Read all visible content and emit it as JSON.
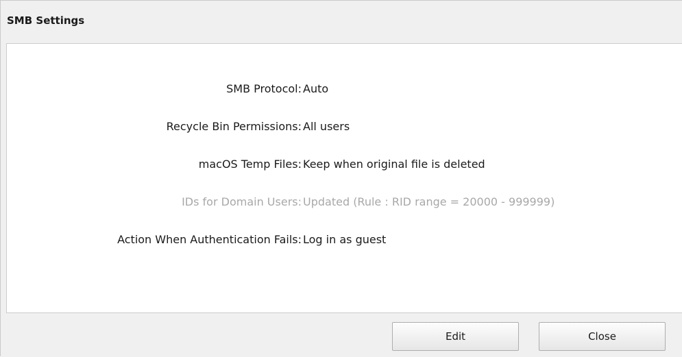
{
  "dialog": {
    "title": "SMB Settings"
  },
  "settings": [
    {
      "label": "SMB Protocol:",
      "value": "Auto",
      "disabled": false
    },
    {
      "label": "Recycle Bin Permissions:",
      "value": "All users",
      "disabled": false
    },
    {
      "label": "macOS Temp Files:",
      "value": "Keep when original file is deleted",
      "disabled": false
    },
    {
      "label": "IDs for Domain Users:",
      "value": "Updated (Rule : RID range = 20000 - 999999)",
      "disabled": true
    },
    {
      "label": "Action When Authentication Fails:",
      "value": "Log in as guest",
      "disabled": false
    }
  ],
  "buttons": {
    "edit_label": "Edit",
    "close_label": "Close"
  },
  "colors": {
    "background": "#f0f0f0",
    "panel": "#ffffff",
    "text": "#1a1a1a",
    "disabled_text": "#a8a8a8"
  }
}
